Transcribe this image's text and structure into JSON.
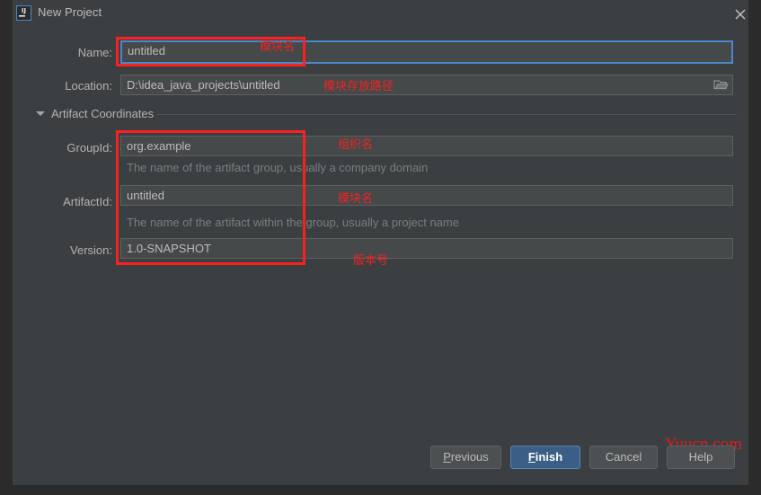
{
  "window": {
    "title": "New Project",
    "app_icon": "intellij-idea-icon",
    "close_icon": "close-icon"
  },
  "form": {
    "name": {
      "label": "Name:",
      "value": "untitled",
      "placeholder": "untitled"
    },
    "location": {
      "label": "Location:",
      "value": "D:\\idea_java_projects\\untitled",
      "placeholder": "D:\\idea_java_projects\\untitled",
      "browse_icon": "folder-icon"
    },
    "artifact_coordinates": {
      "title": "Artifact Coordinates",
      "expanded": true,
      "group_id": {
        "label": "GroupId:",
        "value": "org.example",
        "placeholder": "org.example",
        "hint": "The name of the artifact group, usually a company domain"
      },
      "artifact_id": {
        "label": "ArtifactId:",
        "value": "untitled",
        "placeholder": "untitled",
        "hint": "The name of the artifact within the group, usually a project name"
      },
      "version": {
        "label": "Version:",
        "value": "1.0-SNAPSHOT",
        "placeholder": "1.0-SNAPSHOT"
      }
    }
  },
  "footer": {
    "previous": "Previous",
    "previous_mnemonic": "P",
    "finish": "Finish",
    "finish_mnemonic": "F",
    "cancel": "Cancel",
    "help": "Help"
  },
  "annotations": {
    "name": "模块名",
    "location": "模块存放路径",
    "group_id": "组织名",
    "artifact_id": "模块名",
    "version": "版本号"
  },
  "watermark": "Yuucn.com",
  "colors": {
    "background": "#3c3f41",
    "input_background": "#45494a",
    "input_border": "#5e6060",
    "focus_border": "#4a88c7",
    "text": "#b2b2b2",
    "hint_text": "#7a7d7e",
    "annotation_red": "#f42222",
    "primary_button": "#3b5e86",
    "watermark_red": "#e01b1b"
  }
}
